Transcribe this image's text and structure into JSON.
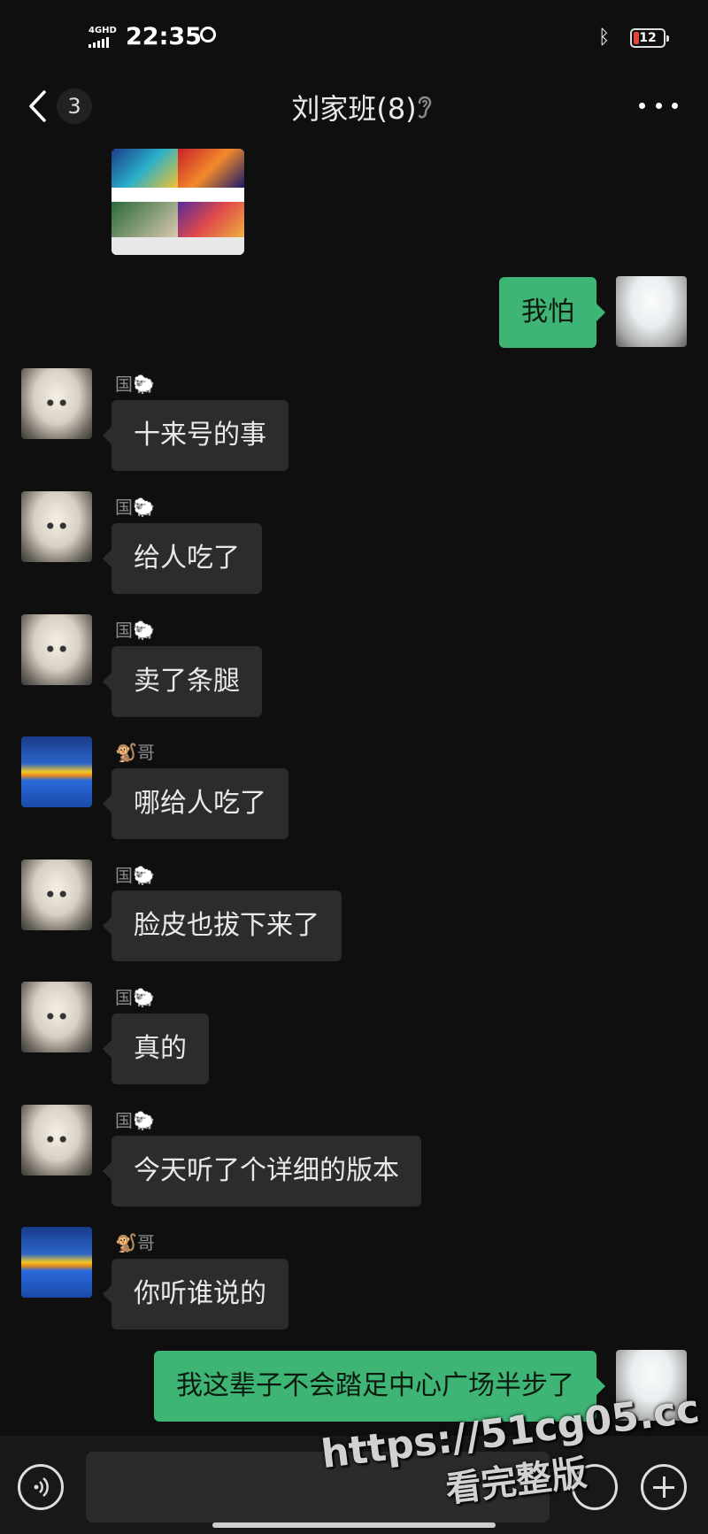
{
  "status_bar": {
    "network": "4GHD",
    "time": "22:35",
    "battery": "12"
  },
  "header": {
    "unread_count": "3",
    "title": "刘家班(8)"
  },
  "messages": [
    {
      "sender": "",
      "text": "我怕"
    },
    {
      "sender": "国🐑",
      "text": "十来号的事"
    },
    {
      "sender": "国🐑",
      "text": "给人吃了"
    },
    {
      "sender": "国🐑",
      "text": "卖了条腿"
    },
    {
      "sender": "🐒哥",
      "text": "哪给人吃了"
    },
    {
      "sender": "国🐑",
      "text": "脸皮也拔下来了"
    },
    {
      "sender": "国🐑",
      "text": "真的"
    },
    {
      "sender": "国🐑",
      "text": "今天听了个详细的版本"
    },
    {
      "sender": "🐒哥",
      "text": "你听谁说的"
    },
    {
      "sender": "",
      "text": "我这辈子不会踏足中心广场半步了"
    }
  ],
  "watermark": {
    "line1": "https://51cg05.cc",
    "line2": "看完整版"
  },
  "colors": {
    "background": "#0f0f0f",
    "incoming_bubble": "#2c2c2c",
    "outgoing_bubble": "#3eb574"
  }
}
